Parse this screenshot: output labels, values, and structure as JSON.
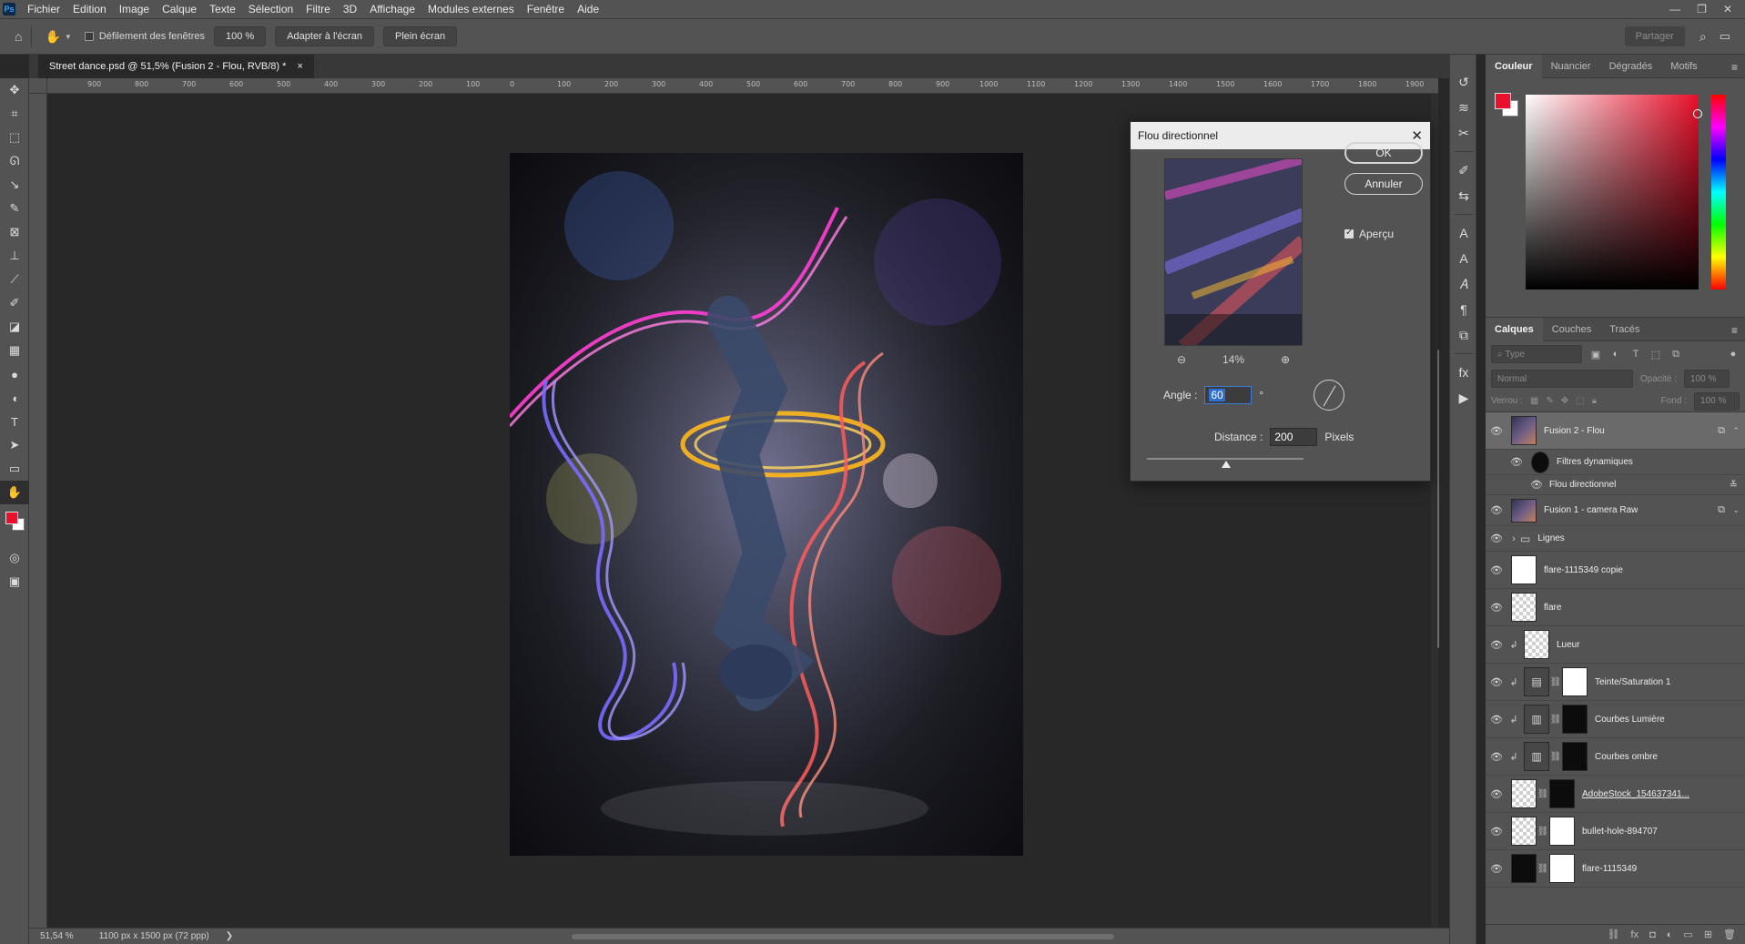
{
  "menu": {
    "logo": "Ps",
    "items": [
      "Fichier",
      "Edition",
      "Image",
      "Calque",
      "Texte",
      "Sélection",
      "Filtre",
      "3D",
      "Affichage",
      "Modules externes",
      "Fenêtre",
      "Aide"
    ],
    "window_controls": {
      "minimize": "—",
      "restore": "❐",
      "close": "✕"
    }
  },
  "options": {
    "scroll_all_label": "Défilement des fenêtres",
    "zoom_label": "100 %",
    "fit_label": "Adapter à l'écran",
    "fullscreen_label": "Plein écran",
    "share_label": "Partager"
  },
  "document_tab": {
    "title": "Street dance.psd @ 51,5% (Fusion 2 - Flou, RVB/8) *",
    "close": "×"
  },
  "ruler": {
    "h_ticks": [
      "900",
      "800",
      "700",
      "600",
      "500",
      "400",
      "300",
      "200",
      "100",
      "0",
      "100",
      "200",
      "300",
      "400",
      "500",
      "600",
      "700",
      "800",
      "900",
      "1000",
      "1100",
      "1200",
      "1300",
      "1400",
      "1500",
      "1600",
      "1700",
      "1800",
      "1900"
    ]
  },
  "status": {
    "zoom": "51,54 %",
    "doc_info": "1100 px x 1500 px (72 ppp)",
    "arrow": "❯"
  },
  "color_panel": {
    "tabs": [
      "Couleur",
      "Nuancier",
      "Dégradés",
      "Motifs"
    ],
    "foreground": "#e8102a",
    "background": "#ffffff"
  },
  "layers_panel": {
    "tabs": [
      "Calques",
      "Couches",
      "Tracés"
    ],
    "filter_placeholder": "Type",
    "blend_mode": "Normal",
    "opacity_label": "Opacité :",
    "opacity_value": "100 %",
    "lock_label": "Verrou :",
    "fill_label": "Fond :",
    "fill_value": "100 %",
    "layers": [
      {
        "name": "Fusion 2 - Flou",
        "thumb": "photo",
        "selected": true
      },
      {
        "name": "Filtres dynamiques",
        "thumb": "black",
        "sub": true
      },
      {
        "name": "Flou directionnel",
        "filter": true
      },
      {
        "name": "Fusion 1 - camera Raw",
        "thumb": "photo"
      },
      {
        "name": "Lignes",
        "group": true
      },
      {
        "name": "flare-1115349 copie",
        "thumb": "white"
      },
      {
        "name": "flare",
        "thumb": "checker"
      },
      {
        "name": "Lueur",
        "thumb": "checker",
        "clip": true
      },
      {
        "name": "Teinte/Saturation 1",
        "thumb": "adj",
        "mask": "white",
        "clip": true
      },
      {
        "name": "Courbes Lumière",
        "thumb": "adj",
        "mask": "black",
        "clip": true
      },
      {
        "name": "Courbes ombre",
        "thumb": "adj",
        "mask": "black",
        "clip": true
      },
      {
        "name": "AdobeStock_154637341...",
        "thumb": "checker",
        "mask": "black",
        "underline": true
      },
      {
        "name": "bullet-hole-894707",
        "thumb": "checker",
        "mask": "white"
      },
      {
        "name": "flare-1115349",
        "thumb": "black",
        "mask": "white"
      }
    ]
  },
  "dialog": {
    "title": "Flou directionnel",
    "ok_label": "OK",
    "cancel_label": "Annuler",
    "preview_label": "Aperçu",
    "preview_checked": true,
    "zoom_percent": "14%",
    "angle_label": "Angle :",
    "angle_value": "60",
    "angle_unit": "°",
    "distance_label": "Distance :",
    "distance_value": "200",
    "distance_unit": "Pixels"
  }
}
